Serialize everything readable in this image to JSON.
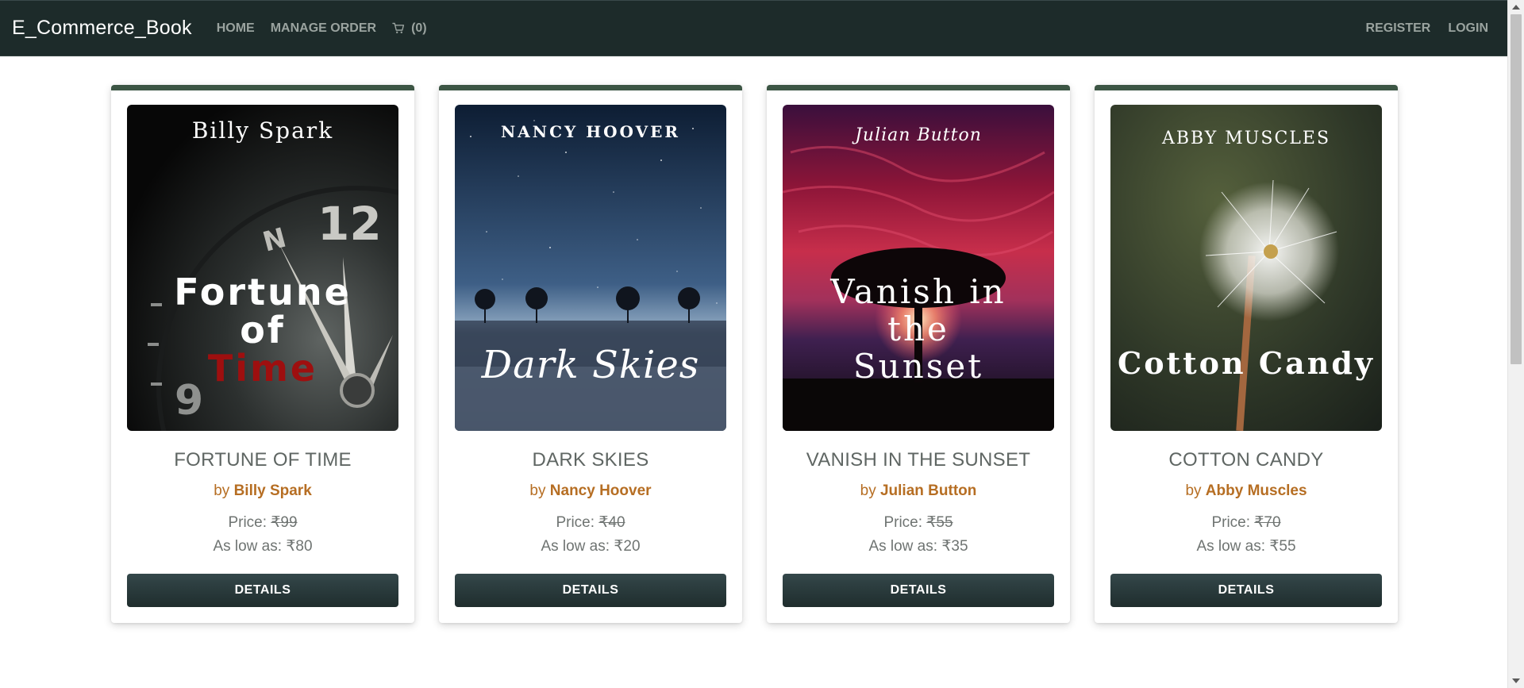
{
  "navbar": {
    "brand": "E_Commerce_Book",
    "links": {
      "home": "HOME",
      "manage_order": "MANAGE ORDER",
      "cart_count": "(0)",
      "register": "REGISTER",
      "login": "LOGIN"
    }
  },
  "colors": {
    "navbar_bg": "#1d2b2a",
    "card_accent": "#3c5544",
    "author_color": "#b66e23",
    "button_bg": "#263637"
  },
  "books": [
    {
      "cover_author": "Billy Spark",
      "cover_title_line1": "Fortune",
      "cover_title_line2": "of",
      "cover_title_line3": "Time",
      "title": "FORTUNE OF TIME",
      "by": "by",
      "author": "Billy Spark",
      "price_label": "Price:",
      "price": "₹99",
      "low_label": "As low as:",
      "low_price": "₹80",
      "button": "DETAILS"
    },
    {
      "cover_author": "NANCY HOOVER",
      "cover_title": "Dark Skies",
      "title": "DARK SKIES",
      "by": "by",
      "author": "Nancy Hoover",
      "price_label": "Price:",
      "price": "₹40",
      "low_label": "As low as:",
      "low_price": "₹20",
      "button": "DETAILS"
    },
    {
      "cover_author": "Julian Button",
      "cover_title_line1": "Vanish in",
      "cover_title_line2": "the",
      "cover_title_line3": "Sunset",
      "title": "VANISH IN THE SUNSET",
      "by": "by",
      "author": "Julian Button",
      "price_label": "Price:",
      "price": "₹55",
      "low_label": "As low as:",
      "low_price": "₹35",
      "button": "DETAILS"
    },
    {
      "cover_author": "ABBY MUSCLES",
      "cover_title": "Cotton Candy",
      "title": "COTTON CANDY",
      "by": "by",
      "author": "Abby Muscles",
      "price_label": "Price:",
      "price": "₹70",
      "low_label": "As low as:",
      "low_price": "₹55",
      "button": "DETAILS"
    }
  ]
}
